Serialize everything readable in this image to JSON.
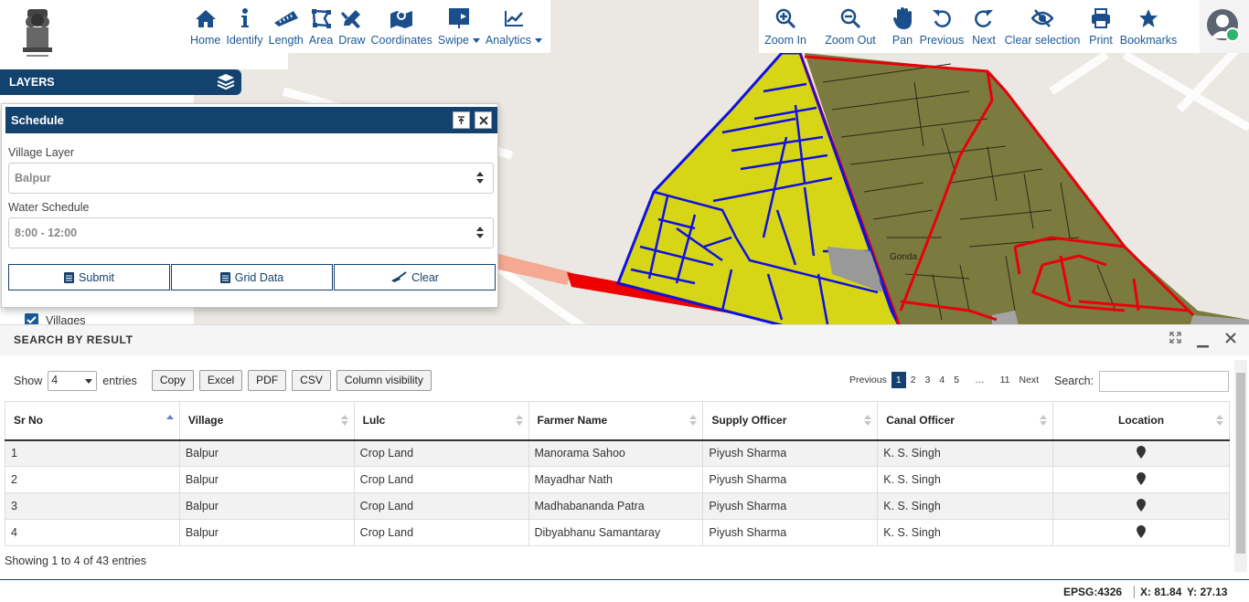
{
  "toolbar": {
    "left_tools": [
      {
        "label": "Home",
        "icon": "home-icon"
      },
      {
        "label": "Identify",
        "icon": "info-icon"
      },
      {
        "label": "Length",
        "icon": "ruler-icon"
      },
      {
        "label": "Area",
        "icon": "area-icon"
      },
      {
        "label": "Draw",
        "icon": "draw-icon"
      },
      {
        "label": "Coordinates",
        "icon": "map-marker-icon"
      },
      {
        "label": "Swipe",
        "icon": "swipe-icon"
      },
      {
        "label": "Analytics",
        "icon": "line-chart-icon"
      }
    ],
    "right_tools": [
      {
        "label": "Zoom In",
        "icon": "zoom-in-icon"
      },
      {
        "label": "Zoom Out",
        "icon": "zoom-out-icon"
      },
      {
        "label": "Pan",
        "icon": "hand-icon"
      },
      {
        "label": "Previous",
        "icon": "undo-icon"
      },
      {
        "label": "Next",
        "icon": "redo-icon"
      },
      {
        "label": "Clear selection",
        "icon": "eye-slash-icon"
      },
      {
        "label": "Print",
        "icon": "print-icon"
      },
      {
        "label": "Bookmarks",
        "icon": "star-icon"
      }
    ],
    "accent": "#1a5a9a"
  },
  "map": {
    "label_gonda": "Gonda",
    "colors": {
      "yellow": "#d6d617",
      "olive": "#7b7b3f",
      "blue": "#1010e0",
      "red": "#e8000a"
    }
  },
  "layers": {
    "title": "LAYERS",
    "villages_label": "Villages"
  },
  "schedule": {
    "title": "Schedule",
    "village_layer_label": "Village Layer",
    "village_layer_value": "Balpur",
    "water_schedule_label": "Water Schedule",
    "water_schedule_value": "8:00 - 12:00",
    "submit_label": "Submit",
    "grid_label": "Grid Data",
    "clear_label": "Clear"
  },
  "results": {
    "title": "SEARCH BY RESULT",
    "show_label": "Show",
    "entries_value": "4",
    "entries_label": "entries",
    "buttons": [
      "Copy",
      "Excel",
      "PDF",
      "CSV",
      "Column visibility"
    ],
    "pager": {
      "previous": "Previous",
      "pages": [
        "1",
        "2",
        "3",
        "4",
        "5",
        "…",
        "11"
      ],
      "next": "Next"
    },
    "search_label": "Search:",
    "columns": [
      "Sr No",
      "Village",
      "Lulc",
      "Farmer Name",
      "Supply Officer",
      "Canal Officer",
      "Location"
    ],
    "rows": [
      [
        "1",
        "Balpur",
        "Crop Land",
        "Manorama Sahoo",
        "Piyush Sharma",
        "K. S. Singh"
      ],
      [
        "2",
        "Balpur",
        "Crop Land",
        "Mayadhar Nath",
        "Piyush Sharma",
        "K. S. Singh"
      ],
      [
        "3",
        "Balpur",
        "Crop Land",
        "Madhabananda Patra",
        "Piyush Sharma",
        "K. S. Singh"
      ],
      [
        "4",
        "Balpur",
        "Crop Land",
        "Dibyabhanu Samantaray",
        "Piyush Sharma",
        "K. S. Singh"
      ]
    ],
    "info": "Showing 1 to 4 of 43 entries"
  },
  "status": {
    "epsg": "EPSG:4326",
    "x": "X: 81.84",
    "y": "Y: 27.13"
  }
}
